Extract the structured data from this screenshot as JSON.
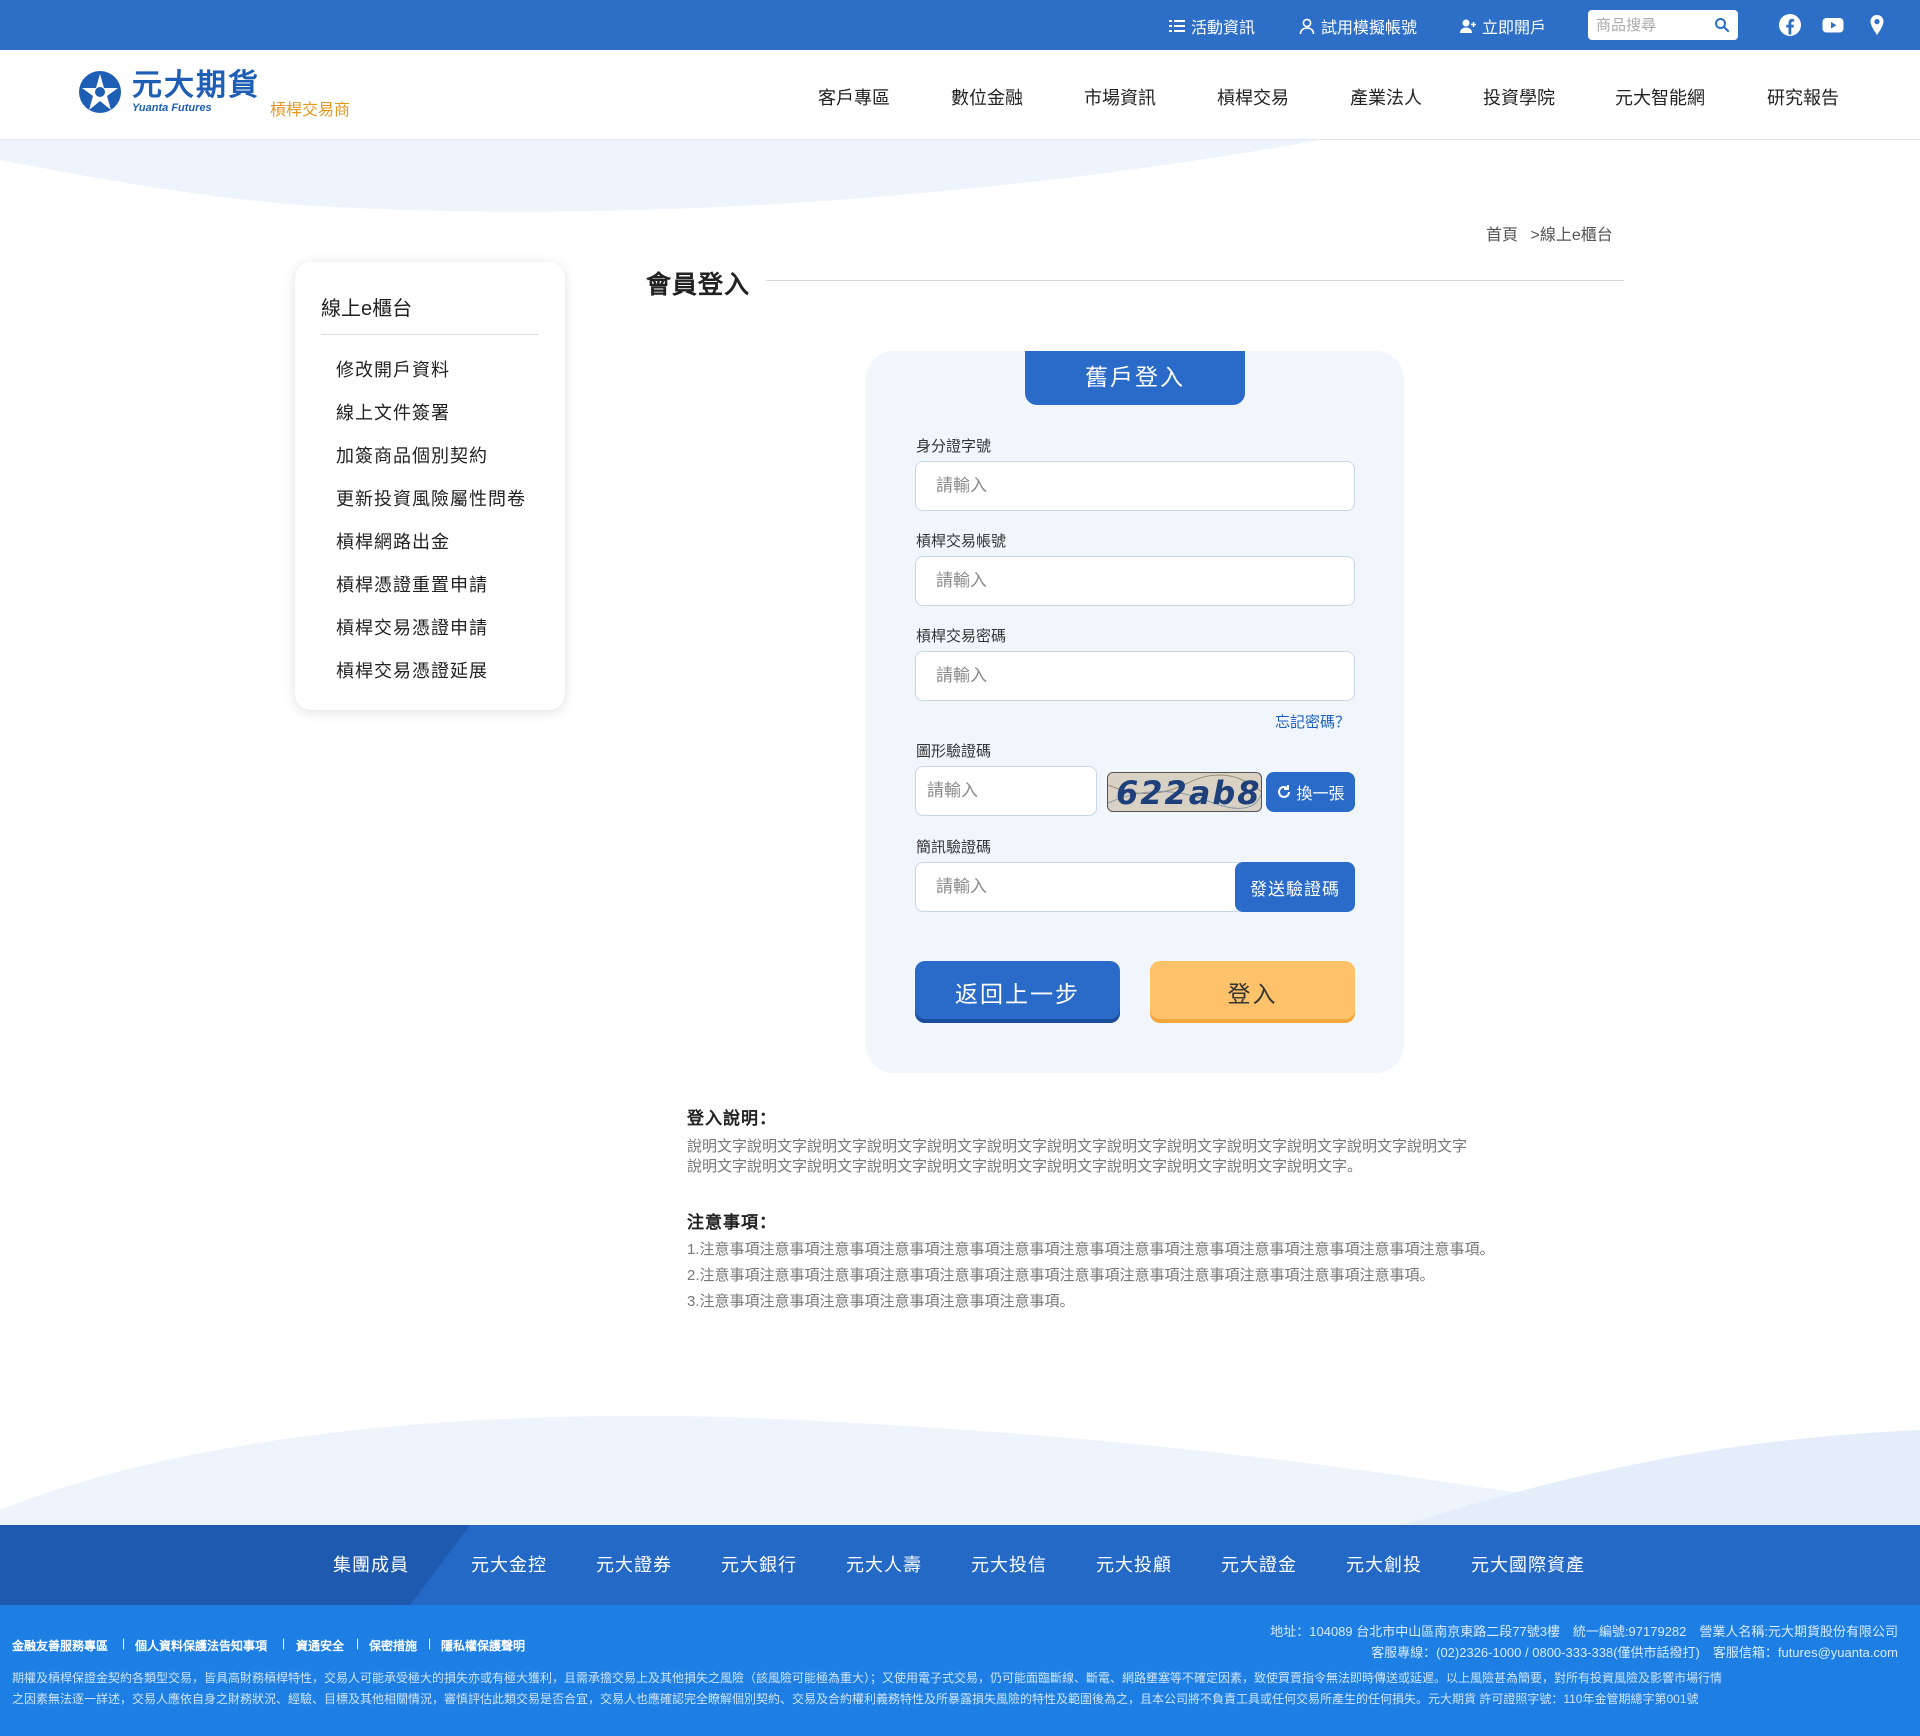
{
  "topbar": {
    "links": [
      {
        "label": "活動資訊",
        "icon": "list-icon"
      },
      {
        "label": "試用模擬帳號",
        "icon": "user-icon"
      },
      {
        "label": "立即開戶",
        "icon": "user-plus-icon"
      }
    ],
    "search_placeholder": "商品搜尋",
    "social": [
      "facebook-icon",
      "youtube-icon",
      "map-pin-icon"
    ]
  },
  "header": {
    "logo_cn": "元大期貨",
    "logo_en": "Yuanta Futures",
    "logo_sub": "槓桿交易商",
    "nav": [
      "客戶專區",
      "數位金融",
      "市場資訊",
      "槓桿交易",
      "產業法人",
      "投資學院",
      "元大智能網",
      "研究報告"
    ]
  },
  "breadcrumb": {
    "home": "首頁",
    "sep": ">",
    "current": "線上e櫃台"
  },
  "sidebar": {
    "title": "線上e櫃台",
    "items": [
      "修改開戶資料",
      "線上文件簽署",
      "加簽商品個別契約",
      "更新投資風險屬性問卷",
      "槓桿網路出金",
      "槓桿憑證重置申請",
      "槓桿交易憑證申請",
      "槓桿交易憑證延展"
    ]
  },
  "page": {
    "title": "會員登入"
  },
  "login": {
    "tab": "舊戶登入",
    "id_label": "身分證字號",
    "id_placeholder": "請輸入",
    "account_label": "槓桿交易帳號",
    "account_placeholder": "請輸入",
    "password_label": "槓桿交易密碼",
    "password_placeholder": "請輸入",
    "forgot": "忘記密碼？",
    "captcha_label": "圖形驗證碼",
    "captcha_placeholder": "請輸入",
    "captcha_text": "622ab8",
    "refresh": "換一張",
    "sms_label": "簡訊驗證碼",
    "sms_placeholder": "請輸入",
    "send_code": "發送驗證碼",
    "back": "返回上一步",
    "submit": "登入"
  },
  "notes": {
    "login_heading": "登入說明：",
    "login_lines": [
      "說明文字說明文字說明文字說明文字說明文字說明文字說明文字說明文字說明文字說明文字說明文字說明文字說明文字",
      "說明文字說明文字說明文字說明文字說明文字說明文字說明文字說明文字說明文字說明文字說明文字。"
    ],
    "caution_heading": "注意事項：",
    "caution_lines": [
      "1.注意事項注意事項注意事項注意事項注意事項注意事項注意事項注意事項注意事項注意事項注意事項注意事項注意事項。",
      "2.注意事項注意事項注意事項注意事項注意事項注意事項注意事項注意事項注意事項注意事項注意事項注意事項。",
      "3.注意事項注意事項注意事項注意事項注意事項注意事項。"
    ]
  },
  "footer": {
    "group_title": "集團成員",
    "groups": [
      "元大金控",
      "元大證券",
      "元大銀行",
      "元大人壽",
      "元大投信",
      "元大投顧",
      "元大證金",
      "元大創投",
      "元大國際資產"
    ],
    "links": [
      "金融友善服務專區",
      "個人資料保護法告知事項",
      "資通安全",
      "保密措施",
      "隱私權保護聲明"
    ],
    "address": "地址：104089 台北市中山區南京東路二段77號3樓　統一編號:97179282　營業人名稱:元大期貨股份有限公司",
    "contact": "客服專線：(02)2326-1000 / 0800-333-338(僅供市話撥打)　客服信箱：futures@yuanta.com",
    "disclaimer_lines": [
      "期權及槓桿保證金契約各類型交易，皆具高財務槓桿特性，交易人可能承受極大的損失亦或有極大獲利，且需承擔交易上及其他損失之風險（該風險可能極為重大）；又使用電子式交易，仍可能面臨斷線、斷電、網路壅塞等不確定因素，致使買賣指令無法即時傳送或延遲。以上風險甚為簡要，對所有投資風險及影響市場行情",
      "之因素無法逐一詳述，交易人應依自身之財務狀況、經驗、目標及其他相關情況，審慎評估此類交易是否合宜，交易人也應確認完全瞭解個別契約、交易及合約權利義務特性及所暴露損失風險的特性及範圍後為之，且本公司將不負責工具或任何交易所產生的任何損失。元大期貨 許可證照字號：110年金管期總字第001號"
    ]
  },
  "colors": {
    "primary": "#2a6bc9",
    "topbar": "#2d6fc6",
    "accent": "#fec36a",
    "footer": "#1d7fe3"
  }
}
